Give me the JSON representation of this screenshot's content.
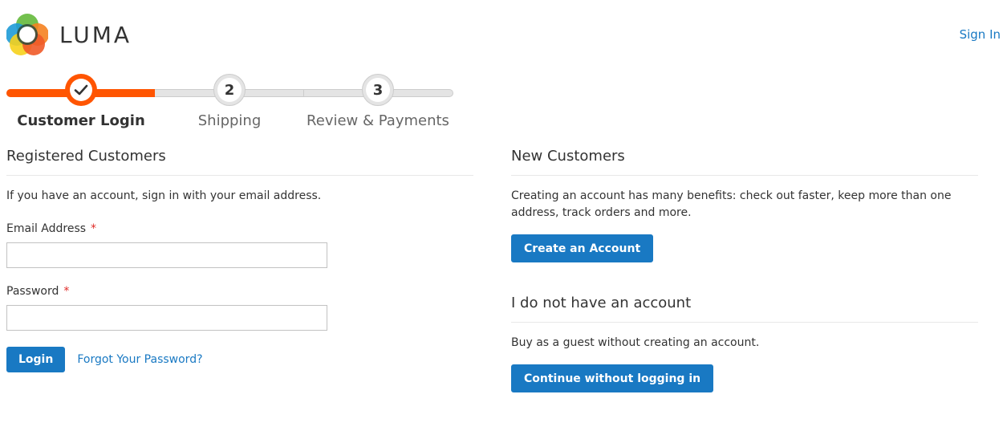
{
  "header": {
    "logo_text": "LUMA",
    "sign_in": "Sign In"
  },
  "progress": {
    "steps": [
      {
        "label": "Customer Login",
        "number": "1",
        "state": "complete"
      },
      {
        "label": "Shipping",
        "number": "2",
        "state": "pending"
      },
      {
        "label": "Review & Payments",
        "number": "3",
        "state": "pending"
      }
    ]
  },
  "login": {
    "title": "Registered Customers",
    "note": "If you have an account, sign in with your email address.",
    "email_label": "Email Address",
    "password_label": "Password",
    "required_mark": "*",
    "email_value": "",
    "password_value": "",
    "login_button": "Login",
    "forgot_link": "Forgot Your Password?"
  },
  "new_customers": {
    "title": "New Customers",
    "note": "Creating an account has many benefits: check out faster, keep more than one address, track orders and more.",
    "create_button": "Create an Account"
  },
  "guest": {
    "title": "I do not have an account",
    "note": "Buy as a guest without creating an account.",
    "continue_button": "Continue without logging in"
  },
  "colors": {
    "accent": "#1979c3",
    "progress": "#ff5501",
    "required": "#e02b27"
  },
  "icons": {
    "logo": "luma-logo-icon",
    "check": "checkmark-icon"
  }
}
